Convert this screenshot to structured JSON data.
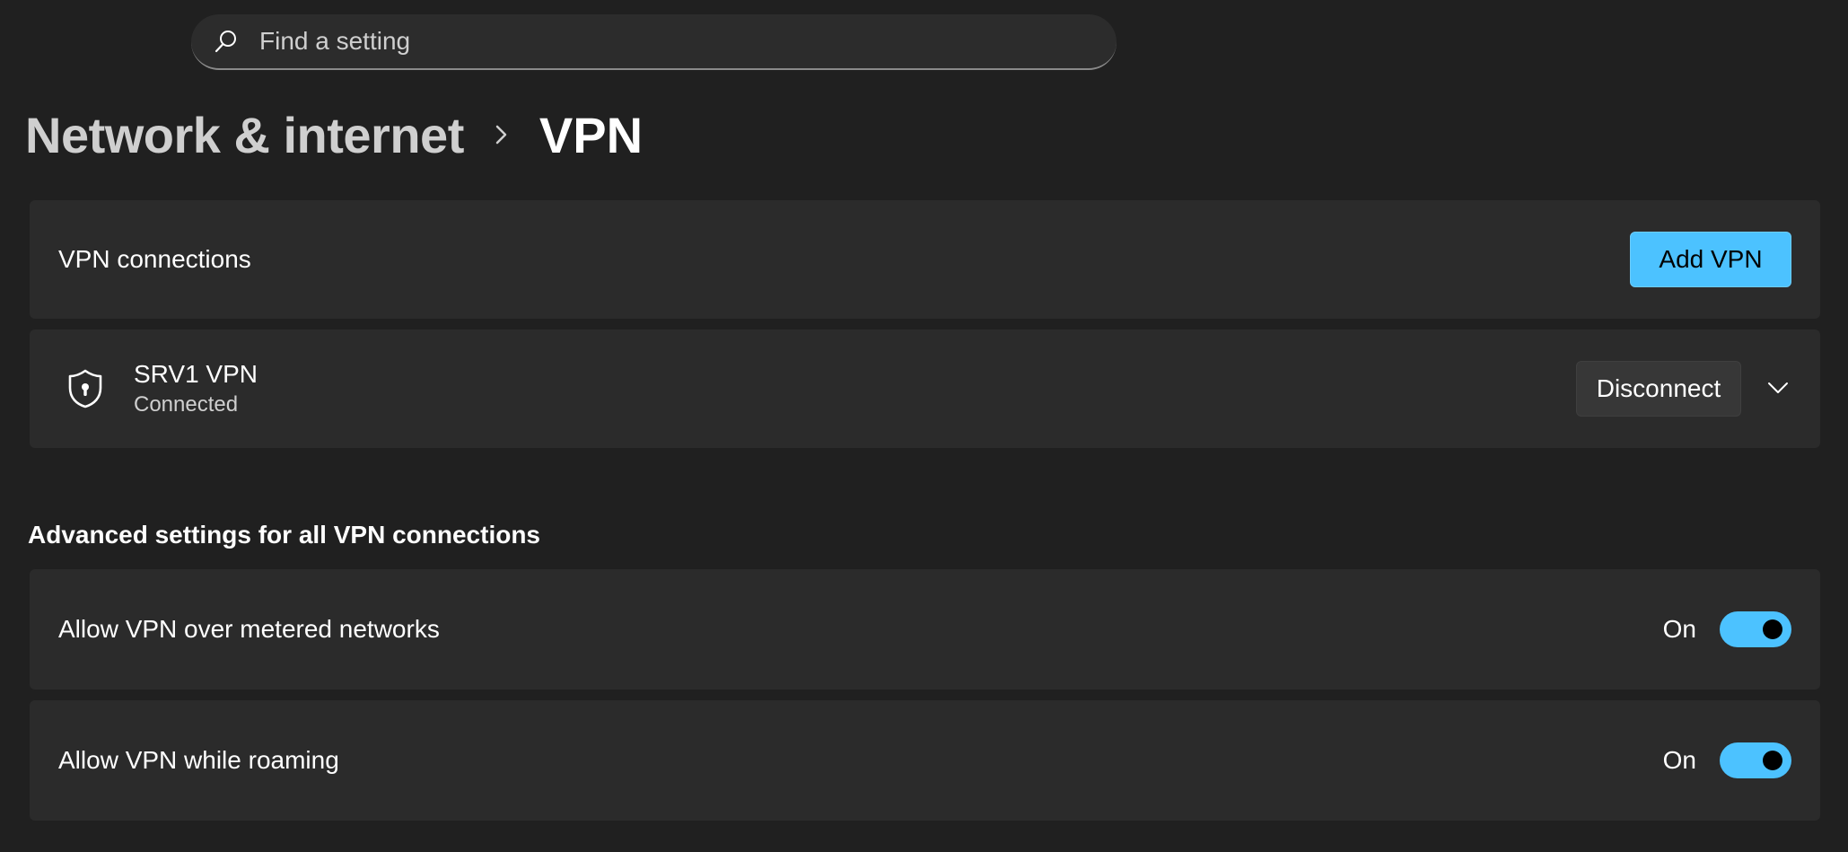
{
  "search": {
    "placeholder": "Find a setting",
    "icon": "search-icon"
  },
  "breadcrumb": {
    "parent": "Network & internet",
    "separator_icon": "chevron-right-icon",
    "current": "VPN"
  },
  "vpn_connections": {
    "label": "VPN connections",
    "add_button_label": "Add VPN"
  },
  "vpn_item": {
    "icon": "shield-lock-icon",
    "name": "SRV1 VPN",
    "status": "Connected",
    "disconnect_label": "Disconnect",
    "expand_icon": "chevron-down-icon"
  },
  "advanced": {
    "title": "Advanced settings for all VPN connections",
    "settings": [
      {
        "label": "Allow VPN over metered networks",
        "state": "On",
        "enabled": true
      },
      {
        "label": "Allow VPN while roaming",
        "state": "On",
        "enabled": true
      }
    ]
  },
  "colors": {
    "background": "#202020",
    "card": "#2b2b2b",
    "accent": "#4cc2ff"
  }
}
